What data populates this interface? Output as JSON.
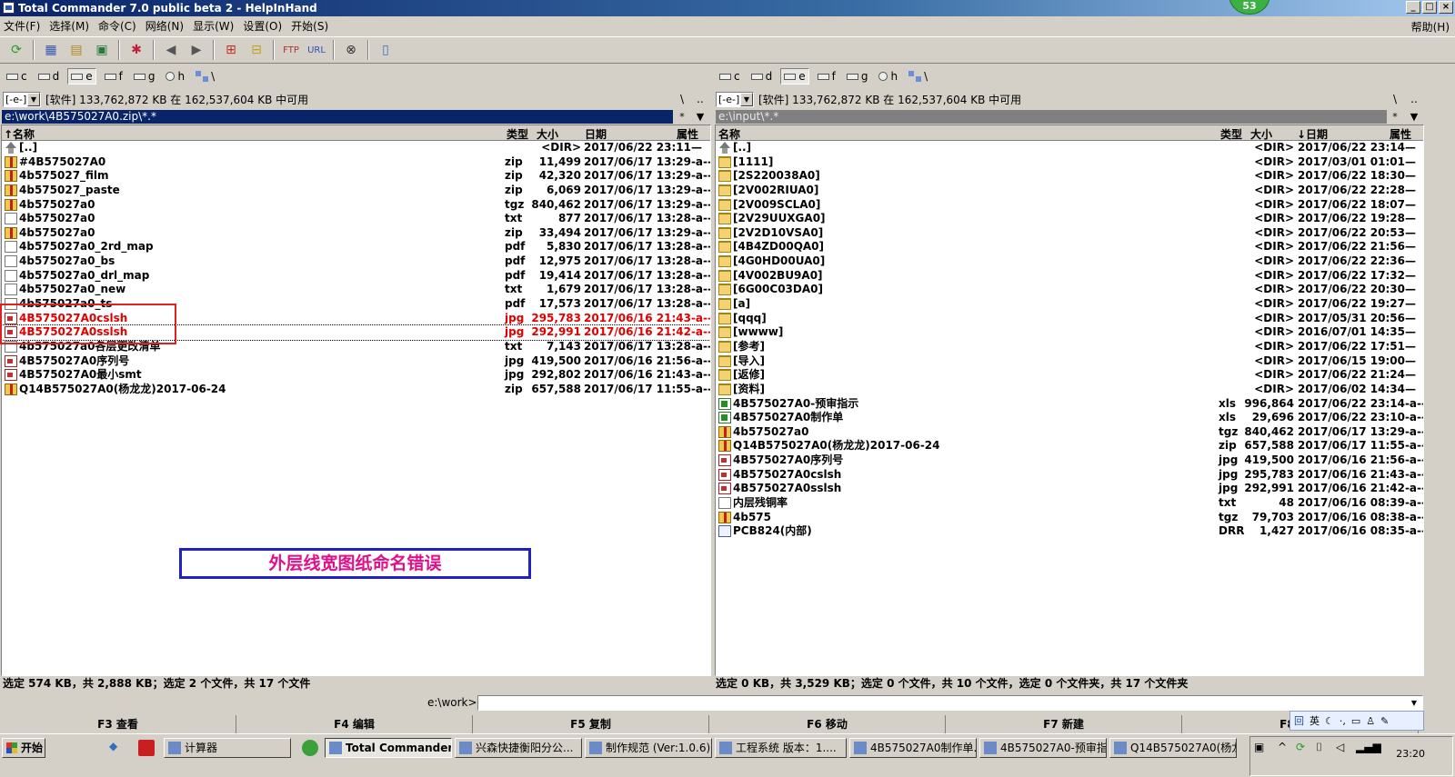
{
  "window": {
    "title": "Total Commander 7.0 public beta 2 - HelpInHand",
    "badge": "53"
  },
  "menu": {
    "items": [
      "文件(F)",
      "选择(M)",
      "命令(C)",
      "网络(N)",
      "显示(W)",
      "设置(O)",
      "开始(S)"
    ],
    "help": "帮助(H)"
  },
  "drives": [
    "c",
    "d",
    "e",
    "f",
    "g",
    "h",
    "\\"
  ],
  "left": {
    "drive_combo": "[-e-]",
    "free_space": "[软件]  133,762,872 KB 在 162,537,604 KB 中可用",
    "path": "e:\\work\\4B575027A0.zip\\*.*",
    "headers": {
      "name": "↑名称",
      "ext": "类型",
      "size": "大小",
      "date": "日期",
      "attr": "属性"
    },
    "rows": [
      {
        "icon": "up",
        "name": "[..]",
        "ext": "",
        "size": "<DIR>",
        "date": "2017/06/22 23:11—",
        "red": false
      },
      {
        "icon": "zip",
        "name": "#4B575027A0",
        "ext": "zip",
        "size": "11,499",
        "date": "2017/06/17 13:29-a--",
        "red": false
      },
      {
        "icon": "zip",
        "name": "4b575027_film",
        "ext": "zip",
        "size": "42,320",
        "date": "2017/06/17 13:29-a--",
        "red": false
      },
      {
        "icon": "zip",
        "name": "4b575027_paste",
        "ext": "zip",
        "size": "6,069",
        "date": "2017/06/17 13:29-a--",
        "red": false
      },
      {
        "icon": "zip",
        "name": "4b575027a0",
        "ext": "tgz",
        "size": "840,462",
        "date": "2017/06/17 13:29-a--",
        "red": false
      },
      {
        "icon": "doc",
        "name": "4b575027a0",
        "ext": "txt",
        "size": "877",
        "date": "2017/06/17 13:28-a--",
        "red": false
      },
      {
        "icon": "zip",
        "name": "4b575027a0",
        "ext": "zip",
        "size": "33,494",
        "date": "2017/06/17 13:29-a--",
        "red": false
      },
      {
        "icon": "doc",
        "name": "4b575027a0_2rd_map",
        "ext": "pdf",
        "size": "5,830",
        "date": "2017/06/17 13:28-a--",
        "red": false
      },
      {
        "icon": "doc",
        "name": "4b575027a0_bs",
        "ext": "pdf",
        "size": "12,975",
        "date": "2017/06/17 13:28-a--",
        "red": false
      },
      {
        "icon": "doc",
        "name": "4b575027a0_drl_map",
        "ext": "pdf",
        "size": "19,414",
        "date": "2017/06/17 13:28-a--",
        "red": false
      },
      {
        "icon": "doc",
        "name": "4b575027a0_new",
        "ext": "txt",
        "size": "1,679",
        "date": "2017/06/17 13:28-a--",
        "red": false
      },
      {
        "icon": "doc",
        "name": "4b575027a0_ts",
        "ext": "pdf",
        "size": "17,573",
        "date": "2017/06/17 13:28-a--",
        "red": false
      },
      {
        "icon": "img",
        "name": "4B575027A0cslsh",
        "ext": "jpg",
        "size": "295,783",
        "date": "2017/06/16 21:43-a--",
        "red": true
      },
      {
        "icon": "img",
        "name": "4B575027A0sslsh",
        "ext": "jpg",
        "size": "292,991",
        "date": "2017/06/16 21:42-a--",
        "red": true
      },
      {
        "icon": "doc",
        "name": "4b575027a0各层更改清单",
        "ext": "txt",
        "size": "7,143",
        "date": "2017/06/17 13:28-a--",
        "red": false
      },
      {
        "icon": "img",
        "name": "4B575027A0序列号",
        "ext": "jpg",
        "size": "419,500",
        "date": "2017/06/16 21:56-a--",
        "red": false
      },
      {
        "icon": "img",
        "name": "4B575027A0最小smt",
        "ext": "jpg",
        "size": "292,802",
        "date": "2017/06/16 21:43-a--",
        "red": false
      },
      {
        "icon": "zip",
        "name": "Q14B575027A0(杨龙龙)2017-06-24",
        "ext": "zip",
        "size": "657,588",
        "date": "2017/06/17 11:55-a--",
        "red": false
      }
    ],
    "status": "选定 574 KB，共 2,888 KB；选定 2 个文件，共 17 个文件"
  },
  "right": {
    "drive_combo": "[-e-]",
    "free_space": "[软件]  133,762,872 KB 在 162,537,604 KB 中可用",
    "path": "e:\\input\\*.*",
    "headers": {
      "name": "名称",
      "ext": "类型",
      "size": "大小",
      "date": "↓日期",
      "attr": "属性"
    },
    "rows": [
      {
        "icon": "up",
        "name": "[..]",
        "ext": "",
        "size": "<DIR>",
        "date": "2017/06/22 23:14—"
      },
      {
        "icon": "folder",
        "name": "[1111]",
        "ext": "",
        "size": "<DIR>",
        "date": "2017/03/01 01:01—"
      },
      {
        "icon": "folder",
        "name": "[2S220038A0]",
        "ext": "",
        "size": "<DIR>",
        "date": "2017/06/22 18:30—"
      },
      {
        "icon": "folder",
        "name": "[2V002RIUA0]",
        "ext": "",
        "size": "<DIR>",
        "date": "2017/06/22 22:28—"
      },
      {
        "icon": "folder",
        "name": "[2V009SCLA0]",
        "ext": "",
        "size": "<DIR>",
        "date": "2017/06/22 18:07—"
      },
      {
        "icon": "folder",
        "name": "[2V29UUXGA0]",
        "ext": "",
        "size": "<DIR>",
        "date": "2017/06/22 19:28—"
      },
      {
        "icon": "folder",
        "name": "[2V2D10VSA0]",
        "ext": "",
        "size": "<DIR>",
        "date": "2017/06/22 20:53—"
      },
      {
        "icon": "folder",
        "name": "[4B4ZD00QA0]",
        "ext": "",
        "size": "<DIR>",
        "date": "2017/06/22 21:56—"
      },
      {
        "icon": "folder",
        "name": "[4G0HD00UA0]",
        "ext": "",
        "size": "<DIR>",
        "date": "2017/06/22 22:36—"
      },
      {
        "icon": "folder",
        "name": "[4V002BU9A0]",
        "ext": "",
        "size": "<DIR>",
        "date": "2017/06/22 17:32—"
      },
      {
        "icon": "folder",
        "name": "[6G00C03DA0]",
        "ext": "",
        "size": "<DIR>",
        "date": "2017/06/22 20:30—"
      },
      {
        "icon": "folder",
        "name": "[a]",
        "ext": "",
        "size": "<DIR>",
        "date": "2017/06/22 19:27—"
      },
      {
        "icon": "folder",
        "name": "[qqq]",
        "ext": "",
        "size": "<DIR>",
        "date": "2017/05/31 20:56—"
      },
      {
        "icon": "folder",
        "name": "[wwww]",
        "ext": "",
        "size": "<DIR>",
        "date": "2016/07/01 14:35—"
      },
      {
        "icon": "folder",
        "name": "[参考]",
        "ext": "",
        "size": "<DIR>",
        "date": "2017/06/22 17:51—"
      },
      {
        "icon": "folder",
        "name": "[导入]",
        "ext": "",
        "size": "<DIR>",
        "date": "2017/06/15 19:00—"
      },
      {
        "icon": "folder",
        "name": "[返修]",
        "ext": "",
        "size": "<DIR>",
        "date": "2017/06/22 21:24—"
      },
      {
        "icon": "folder",
        "name": "[资料]",
        "ext": "",
        "size": "<DIR>",
        "date": "2017/06/02 14:34—"
      },
      {
        "icon": "xls",
        "name": "4B575027A0-预审指示",
        "ext": "xls",
        "size": "996,864",
        "date": "2017/06/22 23:14-a--"
      },
      {
        "icon": "xls",
        "name": "4B575027A0制作单",
        "ext": "xls",
        "size": "29,696",
        "date": "2017/06/22 23:10-a--"
      },
      {
        "icon": "zip",
        "name": "4b575027a0",
        "ext": "tgz",
        "size": "840,462",
        "date": "2017/06/17 13:29-a--"
      },
      {
        "icon": "zip",
        "name": "Q14B575027A0(杨龙龙)2017-06-24",
        "ext": "zip",
        "size": "657,588",
        "date": "2017/06/17 11:55-a--"
      },
      {
        "icon": "img",
        "name": "4B575027A0序列号",
        "ext": "jpg",
        "size": "419,500",
        "date": "2017/06/16 21:56-a--"
      },
      {
        "icon": "img",
        "name": "4B575027A0cslsh",
        "ext": "jpg",
        "size": "295,783",
        "date": "2017/06/16 21:43-a--"
      },
      {
        "icon": "img",
        "name": "4B575027A0sslsh",
        "ext": "jpg",
        "size": "292,991",
        "date": "2017/06/16 21:42-a--"
      },
      {
        "icon": "doc",
        "name": "内层残铜率",
        "ext": "txt",
        "size": "48",
        "date": "2017/06/16 08:39-a--"
      },
      {
        "icon": "zip",
        "name": "4b575",
        "ext": "tgz",
        "size": "79,703",
        "date": "2017/06/16 08:38-a--"
      },
      {
        "icon": "drr",
        "name": "PCB824(内部)",
        "ext": "DRR",
        "size": "1,427",
        "date": "2017/06/16 08:35-a--"
      }
    ],
    "status": "选定 0 KB，共 3,529 KB；选定 0 个文件，共 10 个文件，选定 0 个文件夹，共 17 个文件夹"
  },
  "annotation": "外层线宽图纸命名错误",
  "command": {
    "label": "e:\\work>",
    "value": ""
  },
  "fkeys": [
    "F3 查看",
    "F4 编辑",
    "F5 复制",
    "F6 移动",
    "F7 新建",
    "F8 删除"
  ],
  "ime": {
    "lang": "英"
  },
  "taskbar": {
    "start": "开始",
    "tasks": [
      "计算器",
      "Total Commander ...",
      "兴森快捷衡阳分公...",
      "制作规范 (Ver:1.0.6)",
      "工程系统  版本：1....",
      "4B575027A0制作单....",
      "4B575027A0-预审指...",
      "Q14B575027A0(杨龙..."
    ],
    "clock": "23:20"
  },
  "colors": {
    "title_start": "#0a246a",
    "selected_red": "#e00000",
    "annot_text": "#e0108a",
    "annot_border": "#2020c8"
  }
}
